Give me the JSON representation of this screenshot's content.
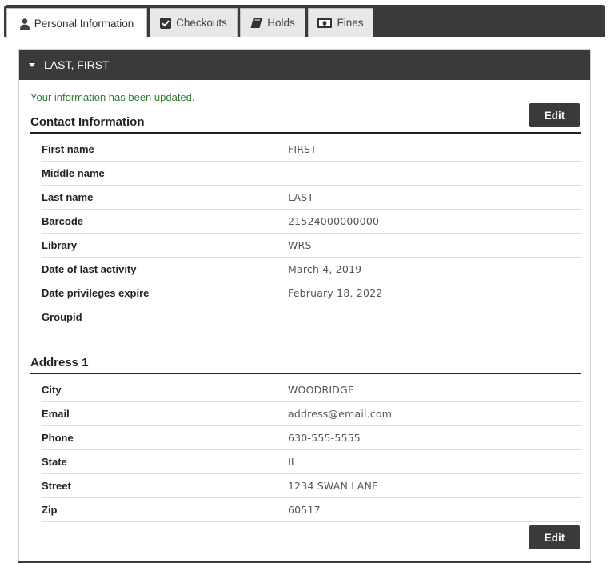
{
  "tabs": [
    {
      "label": "Personal Information",
      "icon": "person-icon",
      "active": true
    },
    {
      "label": "Checkouts",
      "icon": "checkbox-icon",
      "active": false
    },
    {
      "label": "Holds",
      "icon": "book-icon",
      "active": false
    },
    {
      "label": "Fines",
      "icon": "money-icon",
      "active": false
    }
  ],
  "panel": {
    "header": "LAST, FIRST",
    "message": "Your information has been updated.",
    "edit_label": "Edit"
  },
  "contact": {
    "title": "Contact Information",
    "rows": [
      {
        "label": "First name",
        "value": "FIRST"
      },
      {
        "label": "Middle name",
        "value": ""
      },
      {
        "label": "Last name",
        "value": "LAST"
      },
      {
        "label": "Barcode",
        "value": "21524000000000"
      },
      {
        "label": "Library",
        "value": "WRS"
      },
      {
        "label": "Date of last activity",
        "value": "March 4, 2019"
      },
      {
        "label": "Date privileges expire",
        "value": "February 18, 2022"
      },
      {
        "label": "Groupid",
        "value": ""
      }
    ]
  },
  "address": {
    "title": "Address 1",
    "rows": [
      {
        "label": "City",
        "value": "WOODRIDGE"
      },
      {
        "label": "Email",
        "value": "address@email.com"
      },
      {
        "label": "Phone",
        "value": "630-555-5555"
      },
      {
        "label": "State",
        "value": "IL"
      },
      {
        "label": "Street",
        "value": "1234 SWAN LANE"
      },
      {
        "label": "Zip",
        "value": "60517"
      }
    ]
  },
  "colors": {
    "header_bg": "#3a3a3a",
    "success_text": "#2e7d32"
  }
}
